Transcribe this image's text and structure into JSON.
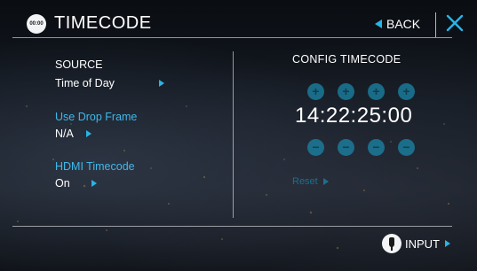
{
  "header": {
    "icon_label": "00:00",
    "title": "TIMECODE",
    "back_label": "BACK"
  },
  "source": {
    "label": "SOURCE",
    "value": "Time of Day"
  },
  "drop_frame": {
    "label": "Use Drop Frame",
    "value": "N/A"
  },
  "hdmi_timecode": {
    "label": "HDMI Timecode",
    "value": "On"
  },
  "config": {
    "title": "CONFIG TIMECODE",
    "timecode": "14:22:25:00",
    "increment_symbol": "+",
    "decrement_symbol": "−",
    "reset_label": "Reset"
  },
  "footer": {
    "input_label": "INPUT"
  },
  "colors": {
    "accent": "#29b4e6",
    "label_blue": "#3fb8ea",
    "dim_button": "#1a86a8"
  }
}
